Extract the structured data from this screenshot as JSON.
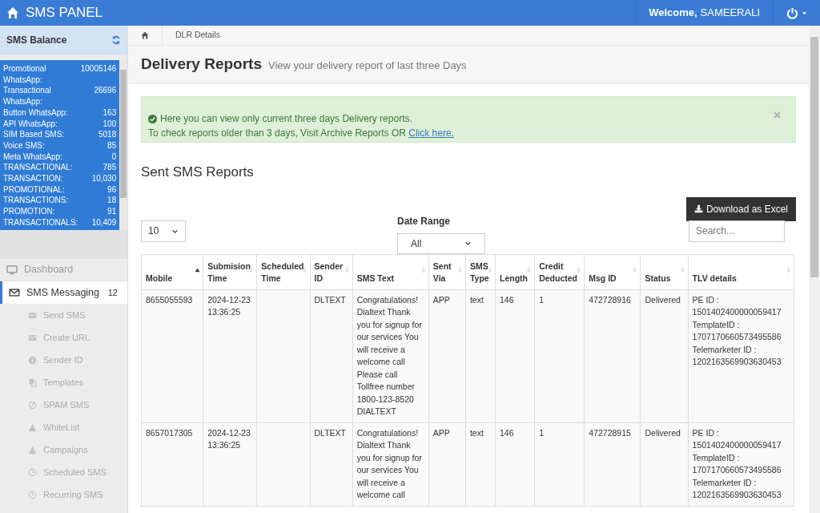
{
  "navbar": {
    "brand": "SMS PANEL",
    "welcome_label": "Welcome,",
    "username": "SAMEERALI"
  },
  "balance": {
    "title": "SMS Balance",
    "items": [
      {
        "label": "Promotional WhatsApp:",
        "value": "10005146"
      },
      {
        "label": "Transactional WhatsApp:",
        "value": "26696"
      },
      {
        "label": "Button WhatsApp:",
        "value": "163"
      },
      {
        "label": "API WhatsApp:",
        "value": "100"
      },
      {
        "label": "SIM Based SMS:",
        "value": "5018"
      },
      {
        "label": "Voice SMS:",
        "value": "85"
      },
      {
        "label": "Meta WhatsApp:",
        "value": "0"
      },
      {
        "label": "TRANSACTIONAL:",
        "value": "785"
      },
      {
        "label": "TRANSACTION:",
        "value": "10,030"
      },
      {
        "label": "PROMOTIONAL:",
        "value": "96"
      },
      {
        "label": "TRANSACTIONS:",
        "value": "18"
      },
      {
        "label": "PROMOTION:",
        "value": "91"
      },
      {
        "label": "TRANSACTIONALS:",
        "value": "10,409"
      }
    ]
  },
  "menu": [
    {
      "label": "Dashboard",
      "kind": "main",
      "selected": false
    },
    {
      "label": "SMS Messaging",
      "kind": "main",
      "selected": true,
      "badge": "12"
    },
    {
      "label": "Send SMS",
      "kind": "sub",
      "selected": false
    },
    {
      "label": "Create URL",
      "kind": "sub",
      "selected": false
    },
    {
      "label": "Sender ID",
      "kind": "sub",
      "selected": false
    },
    {
      "label": "Templates",
      "kind": "sub",
      "selected": false
    },
    {
      "label": "SPAM SMS",
      "kind": "sub",
      "selected": false
    },
    {
      "label": "WhiteList",
      "kind": "sub",
      "selected": false
    },
    {
      "label": "Campaigns",
      "kind": "sub",
      "selected": false
    },
    {
      "label": "Scheduled SMS",
      "kind": "sub",
      "selected": false
    },
    {
      "label": "Recurring SMS",
      "kind": "sub",
      "selected": false
    }
  ],
  "breadcrumb": {
    "current": "DLR Details"
  },
  "page_header": {
    "title": "Delivery Reports",
    "subtitle": "View your delivery report of last three Days"
  },
  "alert": {
    "line1": "Here you can view only current three days Delivery reports.",
    "line2": "To check reports older than 3 days, Visit Archive Reports OR ",
    "link": "Click here."
  },
  "section_title": "Sent SMS Reports",
  "download_button": "Download as Excel",
  "page_size": "10",
  "date_range": {
    "label": "Date Range",
    "value": "All"
  },
  "search": {
    "placeholder": "Search..."
  },
  "table": {
    "columns": [
      {
        "label": "Mobile",
        "sorted": true
      },
      {
        "label": "Submision Time",
        "sorted": false
      },
      {
        "label": "Scheduled Time",
        "sorted": false
      },
      {
        "label": "Sender ID",
        "sorted": false
      },
      {
        "label": "SMS Text",
        "sorted": false
      },
      {
        "label": "Sent Via",
        "sorted": false
      },
      {
        "label": "SMS Type",
        "sorted": false
      },
      {
        "label": "Length",
        "sorted": false
      },
      {
        "label": "Credit Deducted",
        "sorted": false
      },
      {
        "label": "Msg ID",
        "sorted": false
      },
      {
        "label": "Status",
        "sorted": false
      },
      {
        "label": "TLV details",
        "sorted": false
      }
    ],
    "rows": [
      [
        "8655055593",
        "2024-12-23 13:36:25",
        "",
        "DLTEXT",
        "Congratulations! Dialtext Thank you for signup for our services You will receive a welcome call Please call Tollfree number 1800-123-8520 DIALTEXT",
        "APP",
        "text",
        "146",
        "1",
        "472728916",
        "Delivered",
        "PE ID : 1501402400000059417 TemplateID : 1707170660573495586 Telemarketer ID : 1202163569903630453"
      ],
      [
        "8657017305",
        "2024-12-23 13:36:25",
        "",
        "DLTEXT",
        "Congratulations! Dialtext Thank you for signup for our services You will receive a welcome call",
        "APP",
        "text",
        "146",
        "1",
        "472728915",
        "Delivered",
        "PE ID : 1501402400000059417 TemplateID : 1707170660573495586 Telemarketer ID : 1202163569903630453"
      ]
    ]
  }
}
